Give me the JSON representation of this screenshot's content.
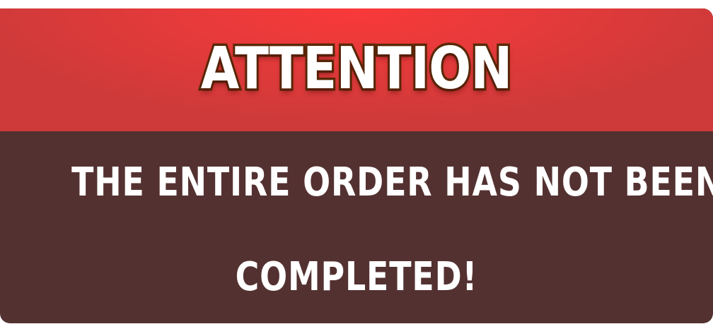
{
  "dialog": {
    "title": "ATTENTION",
    "message_line1": "THE ENTIRE ORDER HAS NOT BEEN",
    "message_line2": "COMPLETED!"
  },
  "colors": {
    "header_red": "#e63a3b",
    "body_brown": "#543131",
    "title_outline": "#5a2a07",
    "text": "#ffffff"
  }
}
